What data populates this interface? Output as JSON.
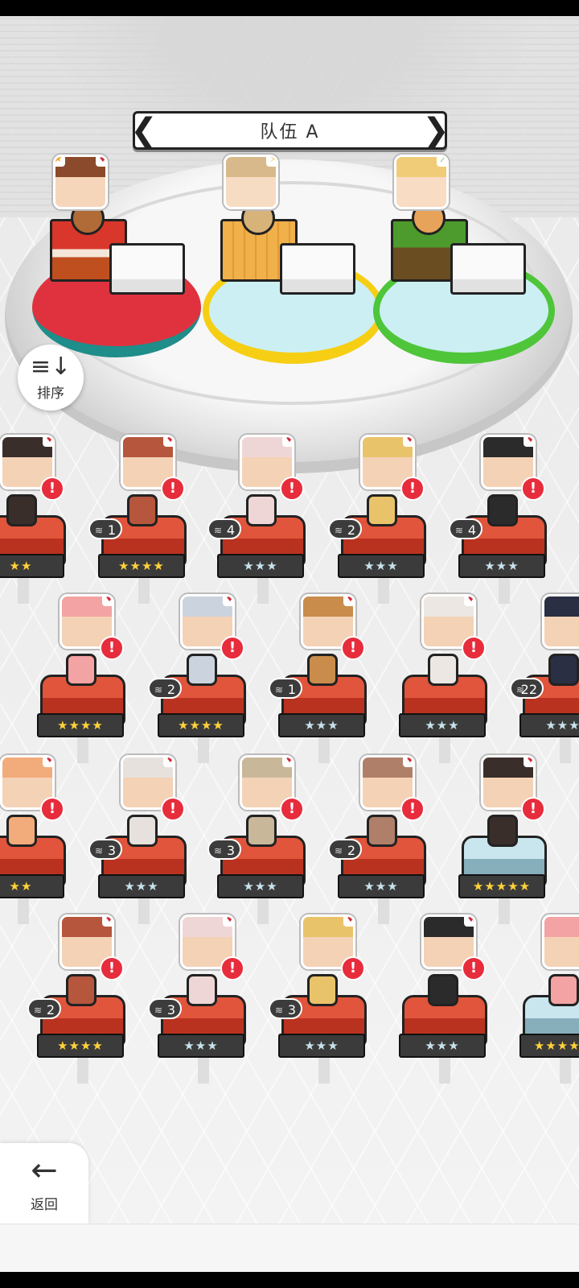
{
  "team": {
    "title": "队伍 A",
    "prev_arrow": "❮",
    "next_arrow": "❯"
  },
  "sort": {
    "label": "排序",
    "icon": "≡↓"
  },
  "back": {
    "label": "返回",
    "icon": "←"
  },
  "element_glyph": "♦",
  "alert_glyph": "!",
  "stack_glyph": "≋",
  "team_slots": [
    {
      "element": "fire",
      "rank": "★",
      "color": "red"
    },
    {
      "element": "lightning",
      "badge": "⚡",
      "color": "yellow"
    },
    {
      "element": "wind",
      "badge": "⟋",
      "color": "green"
    }
  ],
  "roster_rows": [
    {
      "heroes": [
        {
          "stars": "★★",
          "tier": "gold",
          "count": ""
        },
        {
          "stars": "★★★★",
          "tier": "gold",
          "count": "1"
        },
        {
          "stars": "★★★",
          "tier": "silver",
          "count": "4"
        },
        {
          "stars": "★★★",
          "tier": "silver",
          "count": "2"
        },
        {
          "stars": "★★★",
          "tier": "silver",
          "count": "4"
        }
      ]
    },
    {
      "heroes": [
        {
          "stars": "★★★★",
          "tier": "gold",
          "count": ""
        },
        {
          "stars": "★★★★",
          "tier": "gold",
          "count": "2"
        },
        {
          "stars": "★★★",
          "tier": "silver",
          "count": "1"
        },
        {
          "stars": "★★★",
          "tier": "silver",
          "count": ""
        },
        {
          "stars": "★★★",
          "tier": "silver",
          "count": "22"
        }
      ]
    },
    {
      "heroes": [
        {
          "stars": "★★",
          "tier": "gold",
          "count": ""
        },
        {
          "stars": "★★★",
          "tier": "silver",
          "count": "3"
        },
        {
          "stars": "★★★",
          "tier": "silver",
          "count": "3"
        },
        {
          "stars": "★★★",
          "tier": "silver",
          "count": "2"
        },
        {
          "stars": "★★★★★",
          "tier": "gold",
          "count": ""
        }
      ]
    },
    {
      "heroes": [
        {
          "stars": "★★★★",
          "tier": "gold",
          "count": "2"
        },
        {
          "stars": "★★★",
          "tier": "silver",
          "count": "3"
        },
        {
          "stars": "★★★",
          "tier": "silver",
          "count": "3"
        },
        {
          "stars": "★★★",
          "tier": "silver",
          "count": ""
        },
        {
          "stars": "★★★★★",
          "tier": "gold",
          "count": ""
        }
      ]
    }
  ]
}
